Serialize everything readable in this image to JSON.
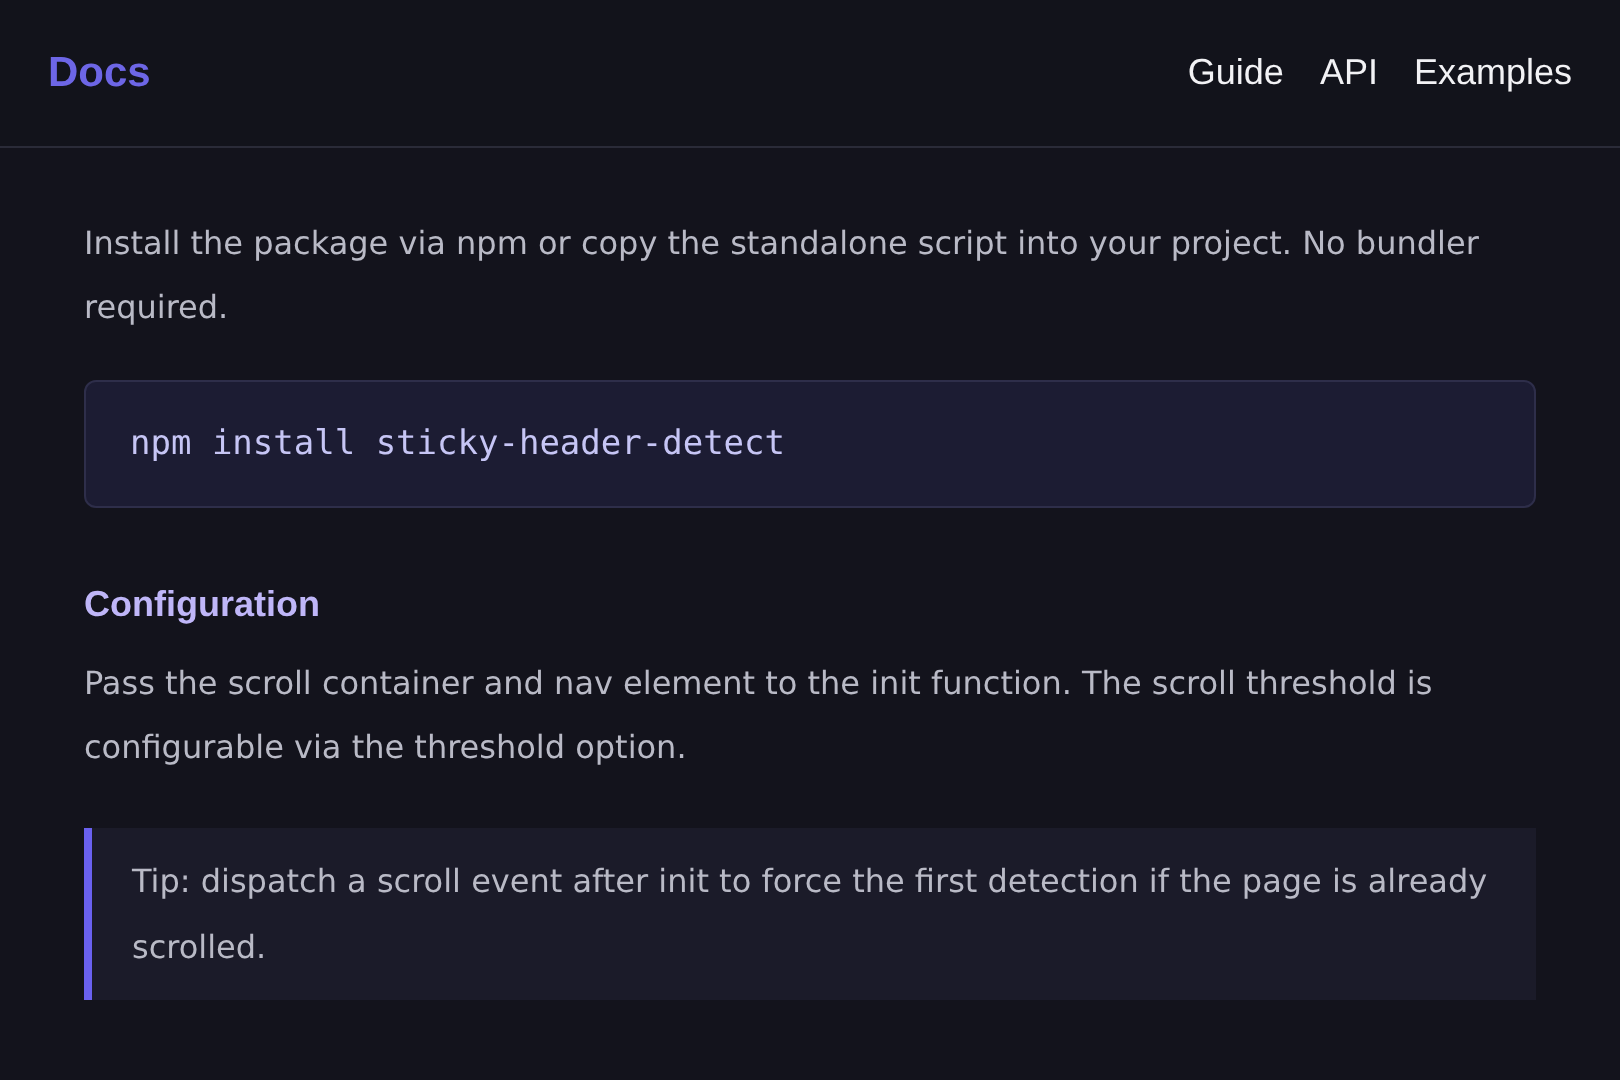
{
  "header": {
    "brand": "Docs",
    "nav": [
      {
        "label": "Guide"
      },
      {
        "label": "API"
      },
      {
        "label": "Examples"
      }
    ]
  },
  "content": [
    {
      "kind": "paragraph",
      "text": "Install the package via npm or copy the standalone script into your project. No bundler required."
    },
    {
      "kind": "code",
      "text": "npm install sticky-header-detect"
    },
    {
      "kind": "subheading",
      "text": "Configuration"
    },
    {
      "kind": "paragraph",
      "text": "Pass the scroll container and nav element to the init function. The scroll threshold is configurable via the threshold option."
    },
    {
      "kind": "tip",
      "text": "Tip: dispatch a scroll event after init to force the first detection if the page is already scrolled."
    }
  ]
}
